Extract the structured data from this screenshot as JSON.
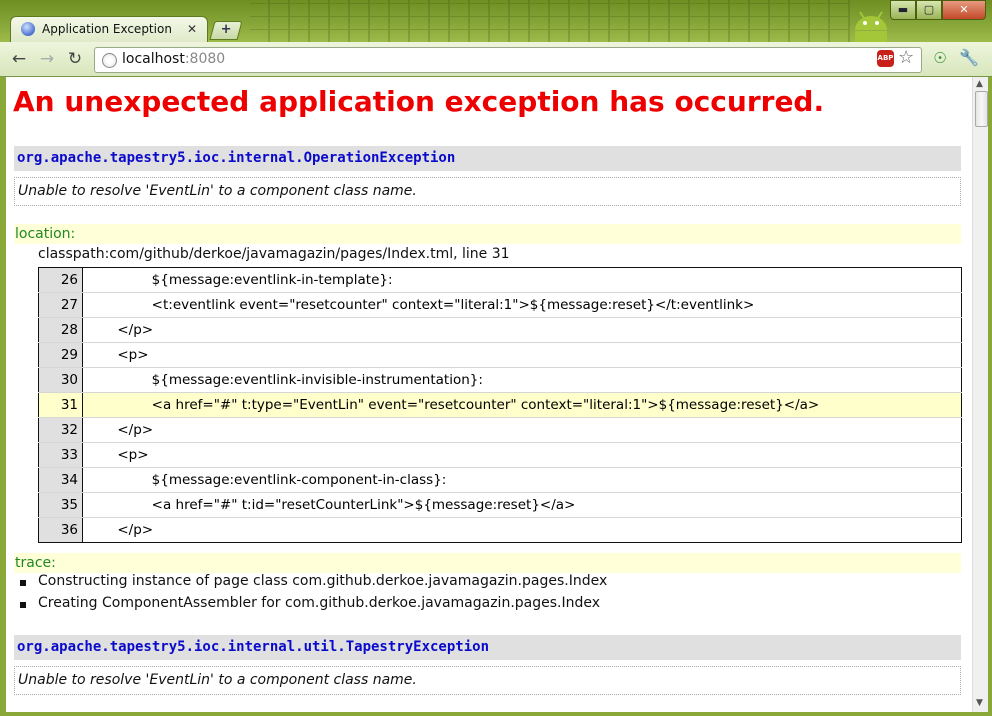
{
  "browser": {
    "tab_title": "Application Exception",
    "tab_close": "✕",
    "new_tab": "+",
    "url_host": "localhost",
    "url_port": ":8080",
    "abp_label": "ABP",
    "window_buttons": {
      "minimize": "▬",
      "maximize": "▢",
      "close": "✕"
    }
  },
  "page": {
    "title": "An unexpected application exception has occurred.",
    "exceptions": [
      {
        "class_name": "org.apache.tapestry5.ioc.internal.OperationException",
        "message": "Unable to resolve 'EventLin' to a component class name.",
        "location_label": "location:",
        "location": "classpath:com/github/derkoe/javamagazin/pages/Index.tml, line 31",
        "source_lines": [
          {
            "num": "26",
            "code": "                ${message:eventlink-in-template}:"
          },
          {
            "num": "27",
            "code": "                <t:eventlink event=\"resetcounter\" context=\"literal:1\">${message:reset}</t:eventlink>"
          },
          {
            "num": "28",
            "code": "        </p>"
          },
          {
            "num": "29",
            "code": "        <p>"
          },
          {
            "num": "30",
            "code": "                ${message:eventlink-invisible-instrumentation}:"
          },
          {
            "num": "31",
            "code": "                <a href=\"#\" t:type=\"EventLin\" event=\"resetcounter\" context=\"literal:1\">${message:reset}</a>",
            "highlight": true
          },
          {
            "num": "32",
            "code": "        </p>"
          },
          {
            "num": "33",
            "code": "        <p>"
          },
          {
            "num": "34",
            "code": "                ${message:eventlink-component-in-class}:"
          },
          {
            "num": "35",
            "code": "                <a href=\"#\" t:id=\"resetCounterLink\">${message:reset}</a>"
          },
          {
            "num": "36",
            "code": "        </p>"
          }
        ],
        "trace_label": "trace:",
        "trace": [
          "Constructing instance of page class com.github.derkoe.javamagazin.pages.Index",
          "Creating ComponentAssembler for com.github.derkoe.javamagazin.pages.Index"
        ]
      },
      {
        "class_name": "org.apache.tapestry5.ioc.internal.util.TapestryException",
        "message": "Unable to resolve 'EventLin' to a component class name."
      }
    ]
  }
}
